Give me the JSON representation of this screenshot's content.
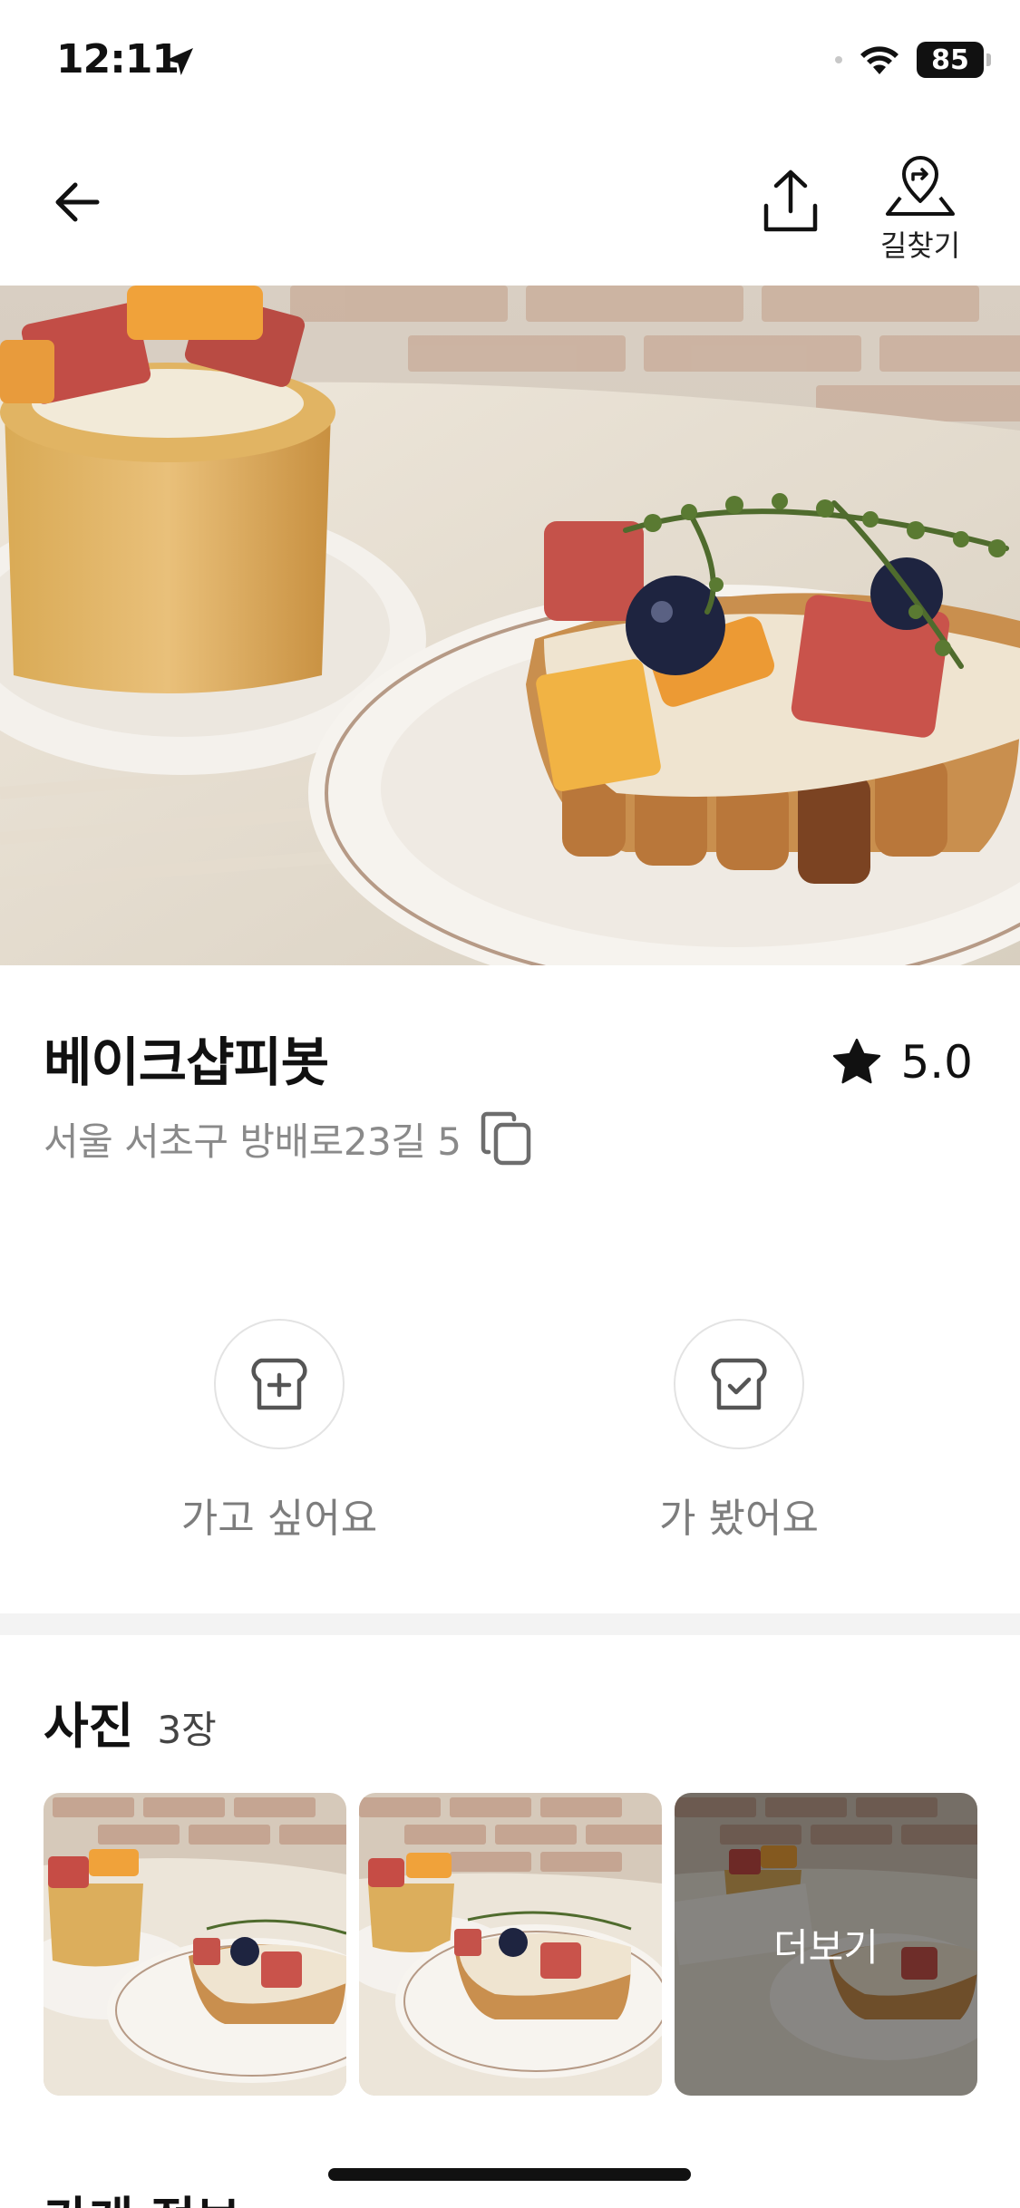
{
  "status_bar": {
    "time": "12:11",
    "battery": "85",
    "icons": [
      "location-arrow-icon",
      "wifi-icon",
      "battery-icon"
    ]
  },
  "nav": {
    "back_icon": "arrow-left-icon",
    "share_icon": "share-icon",
    "route_icon": "map-pin-directions-icon",
    "route_label": "길찾기"
  },
  "hero": {
    "image": "pastry-cake-photo"
  },
  "store": {
    "name": "베이크샵피봇",
    "rating": "5.0",
    "rating_icon": "star-icon",
    "address": "서울 서초구 방배로23길 5",
    "copy_icon": "copy-icon"
  },
  "actions": [
    {
      "label": "가고 싶어요",
      "icon": "bread-plus-icon"
    },
    {
      "label": "가 봤어요",
      "icon": "bread-check-icon"
    }
  ],
  "photos": {
    "heading": "사진",
    "count": "3장",
    "more_label": "더보기",
    "thumbnails": [
      "pastry-photo-1",
      "pastry-photo-2",
      "pastry-photo-3"
    ]
  },
  "next_section_title": "가게 정보",
  "colors": {
    "text_primary": "#111111",
    "text_secondary": "#8a8a8a",
    "divider": "#f3f3f3",
    "circle_border": "#e3e3e3"
  }
}
